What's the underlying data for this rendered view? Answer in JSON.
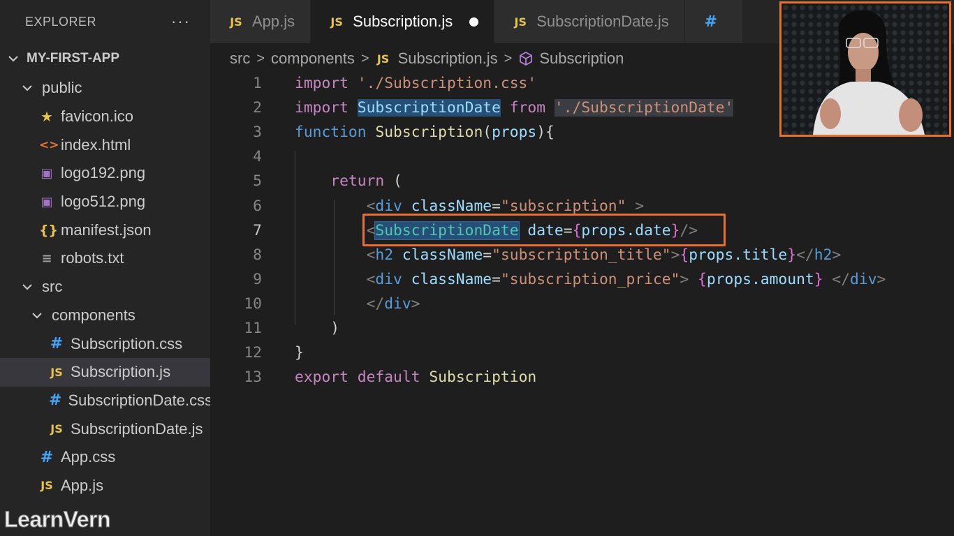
{
  "sidebar": {
    "title": "EXPLORER",
    "more": "···",
    "project": "MY-FIRST-APP",
    "items": [
      {
        "label": "public",
        "type": "folder",
        "depth": 1
      },
      {
        "label": "favicon.ico",
        "icon": "★",
        "icon_name": "star-icon",
        "depth": 2
      },
      {
        "label": "index.html",
        "icon": "<>",
        "icon_name": "html-icon",
        "depth": 2
      },
      {
        "label": "logo192.png",
        "icon": "▣",
        "icon_name": "image-icon",
        "depth": 2
      },
      {
        "label": "logo512.png",
        "icon": "▣",
        "icon_name": "image-icon",
        "depth": 2
      },
      {
        "label": "manifest.json",
        "icon": "{}",
        "icon_name": "json-icon",
        "depth": 2
      },
      {
        "label": "robots.txt",
        "icon": "≡",
        "icon_name": "text-file-icon",
        "depth": 2
      },
      {
        "label": "src",
        "type": "folder",
        "depth": 1
      },
      {
        "label": "components",
        "type": "folder",
        "depth": 2
      },
      {
        "label": "Subscription.css",
        "icon": "#",
        "icon_name": "css-icon",
        "depth": 3
      },
      {
        "label": "Subscription.js",
        "icon": "JS",
        "icon_name": "js-icon",
        "depth": 3,
        "active": true
      },
      {
        "label": "SubscriptionDate.css",
        "icon": "#",
        "icon_name": "css-icon",
        "depth": 3
      },
      {
        "label": "SubscriptionDate.js",
        "icon": "JS",
        "icon_name": "js-icon",
        "depth": 3
      },
      {
        "label": "App.css",
        "icon": "#",
        "icon_name": "css-icon",
        "depth": 2
      },
      {
        "label": "App.js",
        "icon": "JS",
        "icon_name": "js-icon",
        "depth": 2
      }
    ]
  },
  "tabs": [
    {
      "label": "App.js",
      "icon": "JS",
      "active": false
    },
    {
      "label": "Subscription.js",
      "icon": "JS",
      "active": true,
      "modified": true
    },
    {
      "label": "SubscriptionDate.js",
      "icon": "JS",
      "active": false
    },
    {
      "label": "",
      "icon": "#",
      "active": false
    }
  ],
  "breadcrumb": [
    "src",
    "components",
    "Subscription.js",
    "Subscription"
  ],
  "editor": {
    "current_line": 7,
    "lines": [
      {
        "n": "1",
        "tokens": [
          [
            "kw2",
            "import"
          ],
          [
            "",
            " "
          ],
          [
            "str",
            "'./Subscription.css'"
          ]
        ]
      },
      {
        "n": "2",
        "tokens": [
          [
            "kw2",
            "import"
          ],
          [
            "",
            " "
          ],
          [
            "param hl",
            "SubscriptionDate"
          ],
          [
            "",
            " "
          ],
          [
            "kw2",
            "from"
          ],
          [
            "",
            " "
          ],
          [
            "str hl2",
            "'./SubscriptionDate'"
          ]
        ]
      },
      {
        "n": "3",
        "tokens": [
          [
            "kw",
            "function"
          ],
          [
            "",
            " "
          ],
          [
            "fn",
            "Subscription"
          ],
          [
            "",
            "("
          ],
          [
            "param",
            "props"
          ],
          [
            "",
            "){"
          ]
        ]
      },
      {
        "n": "4",
        "tokens": []
      },
      {
        "n": "5",
        "tokens": [
          [
            "",
            "    "
          ],
          [
            "kw2",
            "return"
          ],
          [
            "",
            " ("
          ]
        ]
      },
      {
        "n": "6",
        "tokens": [
          [
            "",
            "        "
          ],
          [
            "punct",
            "<"
          ],
          [
            "tag",
            "div"
          ],
          [
            "",
            " "
          ],
          [
            "attr",
            "className"
          ],
          [
            "",
            "="
          ],
          [
            "str",
            "\"subscription\""
          ],
          [
            "",
            " "
          ],
          [
            "punct",
            ">"
          ]
        ]
      },
      {
        "n": "7",
        "tokens": [
          [
            "",
            "        "
          ],
          [
            "punct",
            "<"
          ],
          [
            "comp hlsel",
            "SubscriptionDate"
          ],
          [
            "",
            " "
          ],
          [
            "attr",
            "date"
          ],
          [
            "",
            "="
          ],
          [
            "brace",
            "{"
          ],
          [
            "param",
            "props.date"
          ],
          [
            "brace",
            "}"
          ],
          [
            "punct",
            "/>"
          ]
        ]
      },
      {
        "n": "8",
        "tokens": [
          [
            "",
            "        "
          ],
          [
            "punct",
            "<"
          ],
          [
            "tag",
            "h2"
          ],
          [
            "",
            " "
          ],
          [
            "attr",
            "className"
          ],
          [
            "",
            "="
          ],
          [
            "str",
            "\"subscription_title\""
          ],
          [
            "punct",
            ">"
          ],
          [
            "brace",
            "{"
          ],
          [
            "param",
            "props.title"
          ],
          [
            "brace",
            "}"
          ],
          [
            "punct",
            "</"
          ],
          [
            "tag",
            "h2"
          ],
          [
            "punct",
            ">"
          ]
        ]
      },
      {
        "n": "9",
        "tokens": [
          [
            "",
            "        "
          ],
          [
            "punct",
            "<"
          ],
          [
            "tag",
            "div"
          ],
          [
            "",
            " "
          ],
          [
            "attr",
            "className"
          ],
          [
            "",
            "="
          ],
          [
            "str",
            "\"subscription_price\""
          ],
          [
            "punct",
            ">"
          ],
          [
            "",
            " "
          ],
          [
            "brace",
            "{"
          ],
          [
            "param",
            "props.amount"
          ],
          [
            "brace",
            "}"
          ],
          [
            "",
            " "
          ],
          [
            "punct",
            "</"
          ],
          [
            "tag",
            "div"
          ],
          [
            "punct",
            ">"
          ]
        ]
      },
      {
        "n": "10",
        "tokens": [
          [
            "",
            "        "
          ],
          [
            "punct",
            "</"
          ],
          [
            "tag",
            "div"
          ],
          [
            "punct",
            ">"
          ]
        ]
      },
      {
        "n": "11",
        "tokens": [
          [
            "",
            "    )"
          ]
        ]
      },
      {
        "n": "12",
        "tokens": [
          [
            "",
            "}"
          ]
        ]
      },
      {
        "n": "13",
        "tokens": [
          [
            "kw2",
            "export"
          ],
          [
            "",
            " "
          ],
          [
            "kw2",
            "default"
          ],
          [
            "",
            " "
          ],
          [
            "fn",
            "Subscription"
          ]
        ]
      }
    ]
  },
  "watermark": "LearnVern",
  "colors": {
    "accent_box": "#e8702a",
    "selection": "#264f78"
  }
}
